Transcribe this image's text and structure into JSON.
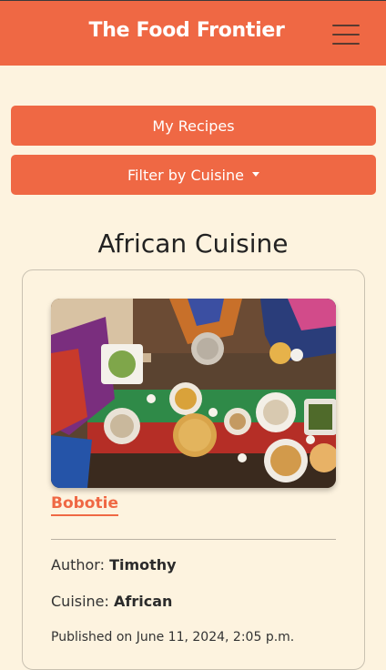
{
  "header": {
    "brand": "The Food Frontier",
    "menu_icon": "hamburger-menu-icon"
  },
  "actions": {
    "my_recipes": "My Recipes",
    "filter_by_cuisine": "Filter by Cuisine"
  },
  "section": {
    "title": "African Cuisine"
  },
  "recipe": {
    "title": "Bobotie",
    "author_label": "Author:",
    "author": "Timothy",
    "cuisine_label": "Cuisine:",
    "cuisine": "African",
    "published": "Published on June 11, 2024, 2:05 p.m."
  },
  "colors": {
    "accent": "#ef6844",
    "background": "#fdf3df"
  }
}
